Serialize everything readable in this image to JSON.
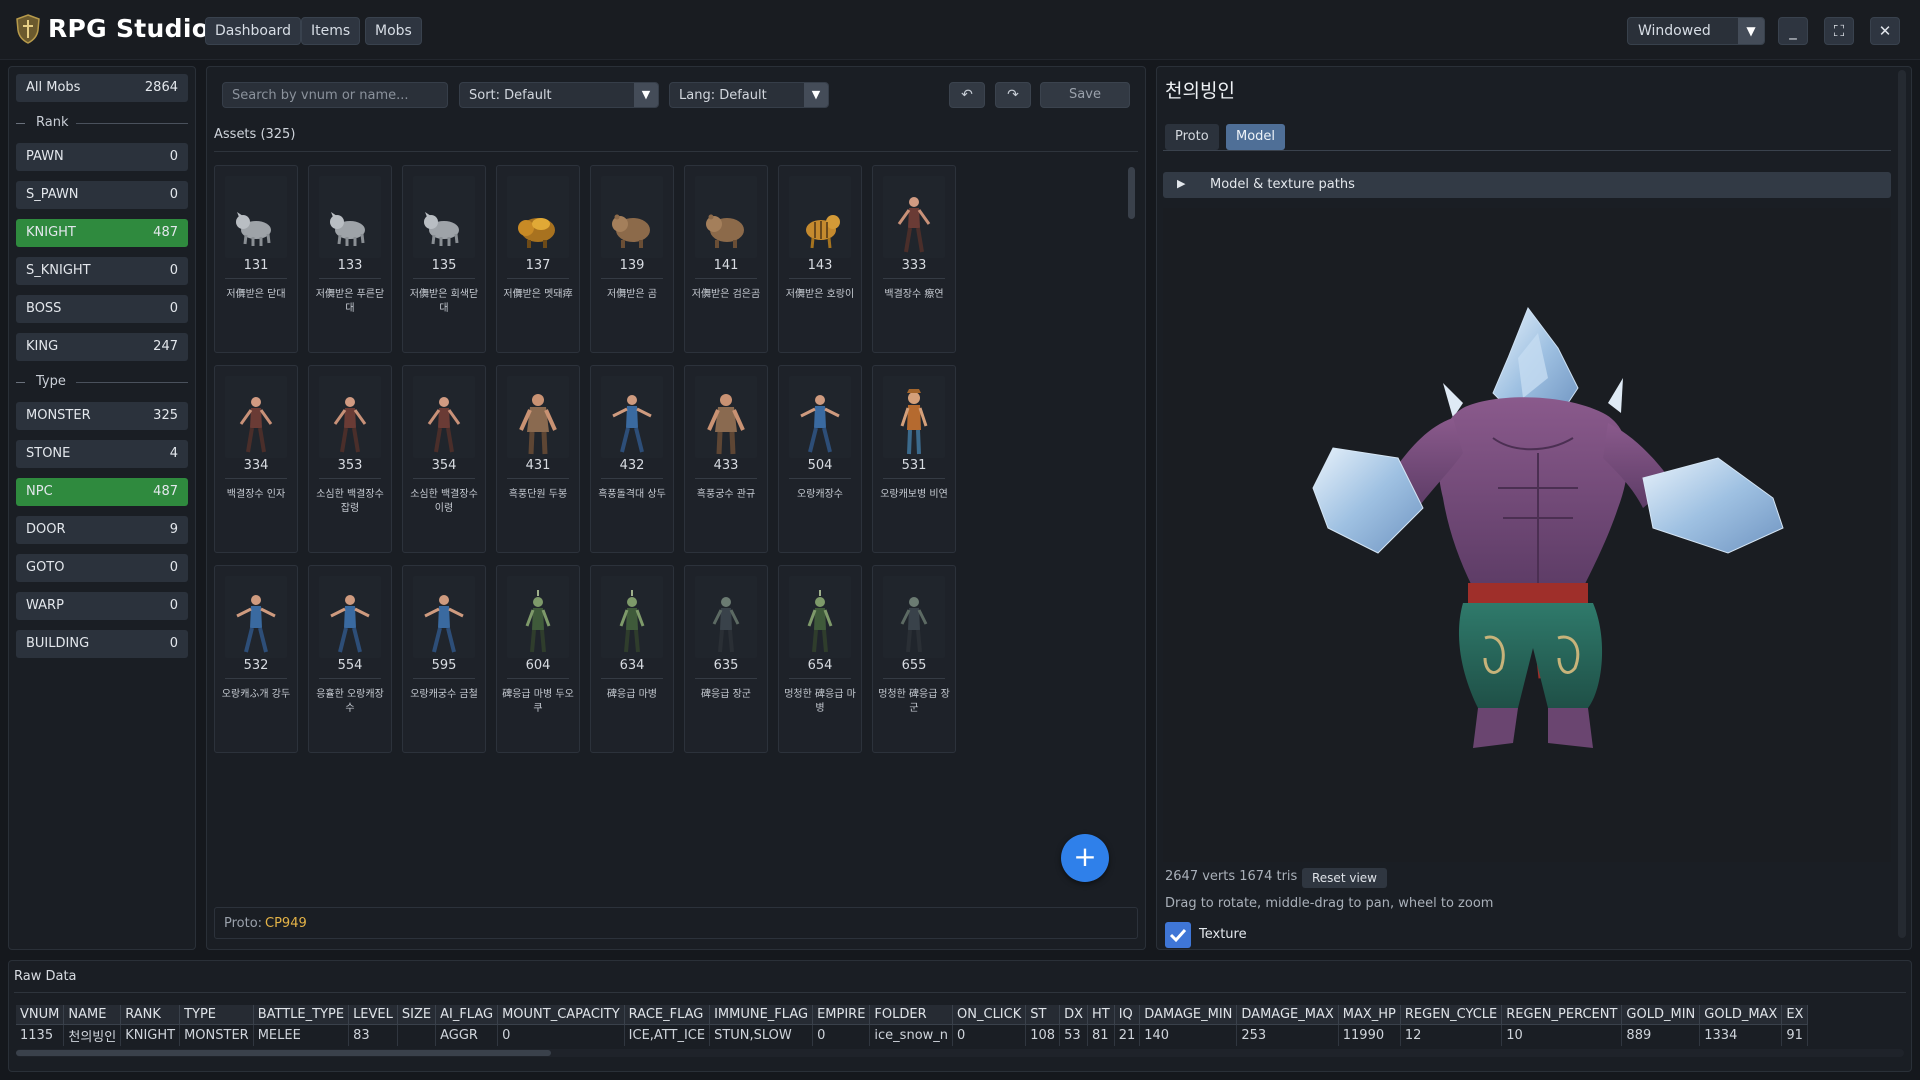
{
  "app": {
    "title": "RPG Studio",
    "nav": [
      "Dashboard",
      "Items",
      "Mobs"
    ],
    "window_mode": "Windowed",
    "colors": {
      "accent_green": "#2f8a3e",
      "accent_blue": "#2f80ea",
      "proto_value": "#e4b347"
    }
  },
  "sidebar": {
    "all": {
      "label": "All Mobs",
      "count": "2864"
    },
    "rank_label": "Rank",
    "rank_items": [
      {
        "label": "PAWN",
        "count": "0",
        "active": false
      },
      {
        "label": "S_PAWN",
        "count": "0",
        "active": false
      },
      {
        "label": "KNIGHT",
        "count": "487",
        "active": true
      },
      {
        "label": "S_KNIGHT",
        "count": "0",
        "active": false
      },
      {
        "label": "BOSS",
        "count": "0",
        "active": false
      },
      {
        "label": "KING",
        "count": "247",
        "active": false
      }
    ],
    "type_label": "Type",
    "type_items": [
      {
        "label": "MONSTER",
        "count": "325",
        "active": false
      },
      {
        "label": "STONE",
        "count": "4",
        "active": false
      },
      {
        "label": "NPC",
        "count": "487",
        "active": true
      },
      {
        "label": "DOOR",
        "count": "9",
        "active": false
      },
      {
        "label": "GOTO",
        "count": "0",
        "active": false
      },
      {
        "label": "WARP",
        "count": "0",
        "active": false
      },
      {
        "label": "BUILDING",
        "count": "0",
        "active": false
      }
    ]
  },
  "toolbar": {
    "search_placeholder": "Search by vnum or name...",
    "sort": "Sort: Default",
    "lang": "Lang: Default",
    "save": "Save"
  },
  "assets": {
    "header": "Assets (325)",
    "items": [
      {
        "vnum": "131",
        "name": "저儛받은 닫대",
        "icon": "wolf-icon"
      },
      {
        "vnum": "133",
        "name": "저儛받은 푸른닫대",
        "icon": "wolf-icon"
      },
      {
        "vnum": "135",
        "name": "저儛받은 회색닫대",
        "icon": "wolf-icon"
      },
      {
        "vnum": "137",
        "name": "저儛받은 멧돼瘁",
        "icon": "boar-icon"
      },
      {
        "vnum": "139",
        "name": "저儛받은 곰",
        "icon": "bear-icon"
      },
      {
        "vnum": "141",
        "name": "저儛받은 검은곰",
        "icon": "bear-icon"
      },
      {
        "vnum": "143",
        "name": "저儛받은 호랑이",
        "icon": "tiger-icon"
      },
      {
        "vnum": "333",
        "name": "백결장수 瘵연",
        "icon": "warrior-icon"
      },
      {
        "vnum": "334",
        "name": "백결장수 인자",
        "icon": "warrior-icon"
      },
      {
        "vnum": "353",
        "name": "소심한 백결장수 잡령",
        "icon": "warrior-icon"
      },
      {
        "vnum": "354",
        "name": "소심한 백결장수 이령",
        "icon": "warrior-icon"
      },
      {
        "vnum": "431",
        "name": "흑풍단원 두봉",
        "icon": "brute-icon"
      },
      {
        "vnum": "432",
        "name": "흑풍돌격대 상두",
        "icon": "fighter-icon"
      },
      {
        "vnum": "433",
        "name": "흑풍궁수 관규",
        "icon": "brute-icon"
      },
      {
        "vnum": "504",
        "name": "오랑캐장수",
        "icon": "fighter-icon"
      },
      {
        "vnum": "531",
        "name": "오랑캐보병 비연",
        "icon": "soldier-icon"
      },
      {
        "vnum": "532",
        "name": "오랑캐ふ개 강두",
        "icon": "fighter-icon"
      },
      {
        "vnum": "554",
        "name": "응휼한 오랑캐장수",
        "icon": "fighter-icon"
      },
      {
        "vnum": "595",
        "name": "오랑캐궁수 금철",
        "icon": "fighter-icon"
      },
      {
        "vnum": "604",
        "name": "碑응급 마병 두오쿠",
        "icon": "orc-icon"
      },
      {
        "vnum": "634",
        "name": "碑응급 마병",
        "icon": "orc-icon"
      },
      {
        "vnum": "635",
        "name": "碑응급 장군",
        "icon": "dark-warrior-icon"
      },
      {
        "vnum": "654",
        "name": "멍청한 碑응급 마병",
        "icon": "orc-icon"
      },
      {
        "vnum": "655",
        "name": "멍청한 碑응급 장군",
        "icon": "dark-warrior-icon"
      }
    ],
    "add_label": "+"
  },
  "proto": {
    "label": "Proto:",
    "value": "CP949"
  },
  "detail": {
    "title": "천의빙인",
    "tabs": [
      {
        "label": "Proto",
        "active": false
      },
      {
        "label": "Model",
        "active": true
      }
    ],
    "section": "Model & texture paths",
    "stats": "2647 verts  1674 tris",
    "reset": "Reset view",
    "hint": "Drag to rotate, middle-drag to pan, wheel to zoom",
    "texture_label": "Texture",
    "texture_checked": true
  },
  "raw": {
    "title": "Raw Data",
    "columns": [
      "VNUM",
      "NAME",
      "RANK",
      "TYPE",
      "BATTLE_TYPE",
      "LEVEL",
      "SIZE",
      "AI_FLAG",
      "MOUNT_CAPACITY",
      "RACE_FLAG",
      "IMMUNE_FLAG",
      "EMPIRE",
      "FOLDER",
      "ON_CLICK",
      "ST",
      "DX",
      "HT",
      "IQ",
      "DAMAGE_MIN",
      "DAMAGE_MAX",
      "MAX_HP",
      "REGEN_CYCLE",
      "REGEN_PERCENT",
      "GOLD_MIN",
      "GOLD_MAX",
      "EX"
    ],
    "row": [
      "1135",
      "천의빙인",
      "KNIGHT",
      "MONSTER",
      "MELEE",
      "83",
      "",
      "AGGR",
      "0",
      "ICE,ATT_ICE",
      "STUN,SLOW",
      "0",
      "ice_snow_n",
      "0",
      "108",
      "53",
      "81",
      "21",
      "140",
      "253",
      "11990",
      "12",
      "10",
      "889",
      "1334",
      "91"
    ]
  }
}
